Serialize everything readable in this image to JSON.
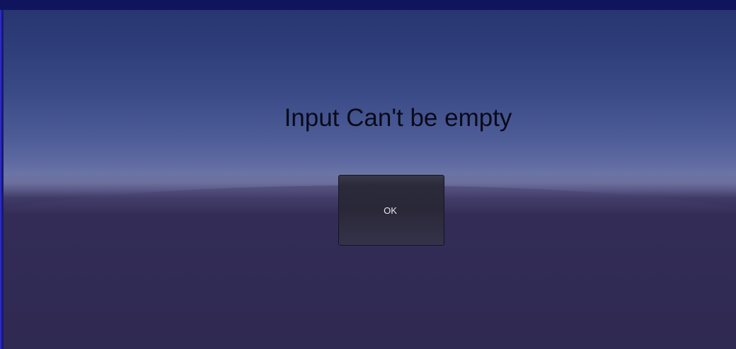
{
  "dialog": {
    "message": "Input Can't be empty",
    "ok_label": "OK"
  },
  "colors": {
    "top_bar": "#10145c",
    "sky_top": "#283570",
    "horizon_glow": "#6a74a6",
    "ground": "#2f2a52",
    "message_text": "#0a0a1a",
    "button_bg": "#2b2a3a",
    "button_text": "#e6e6ee"
  }
}
